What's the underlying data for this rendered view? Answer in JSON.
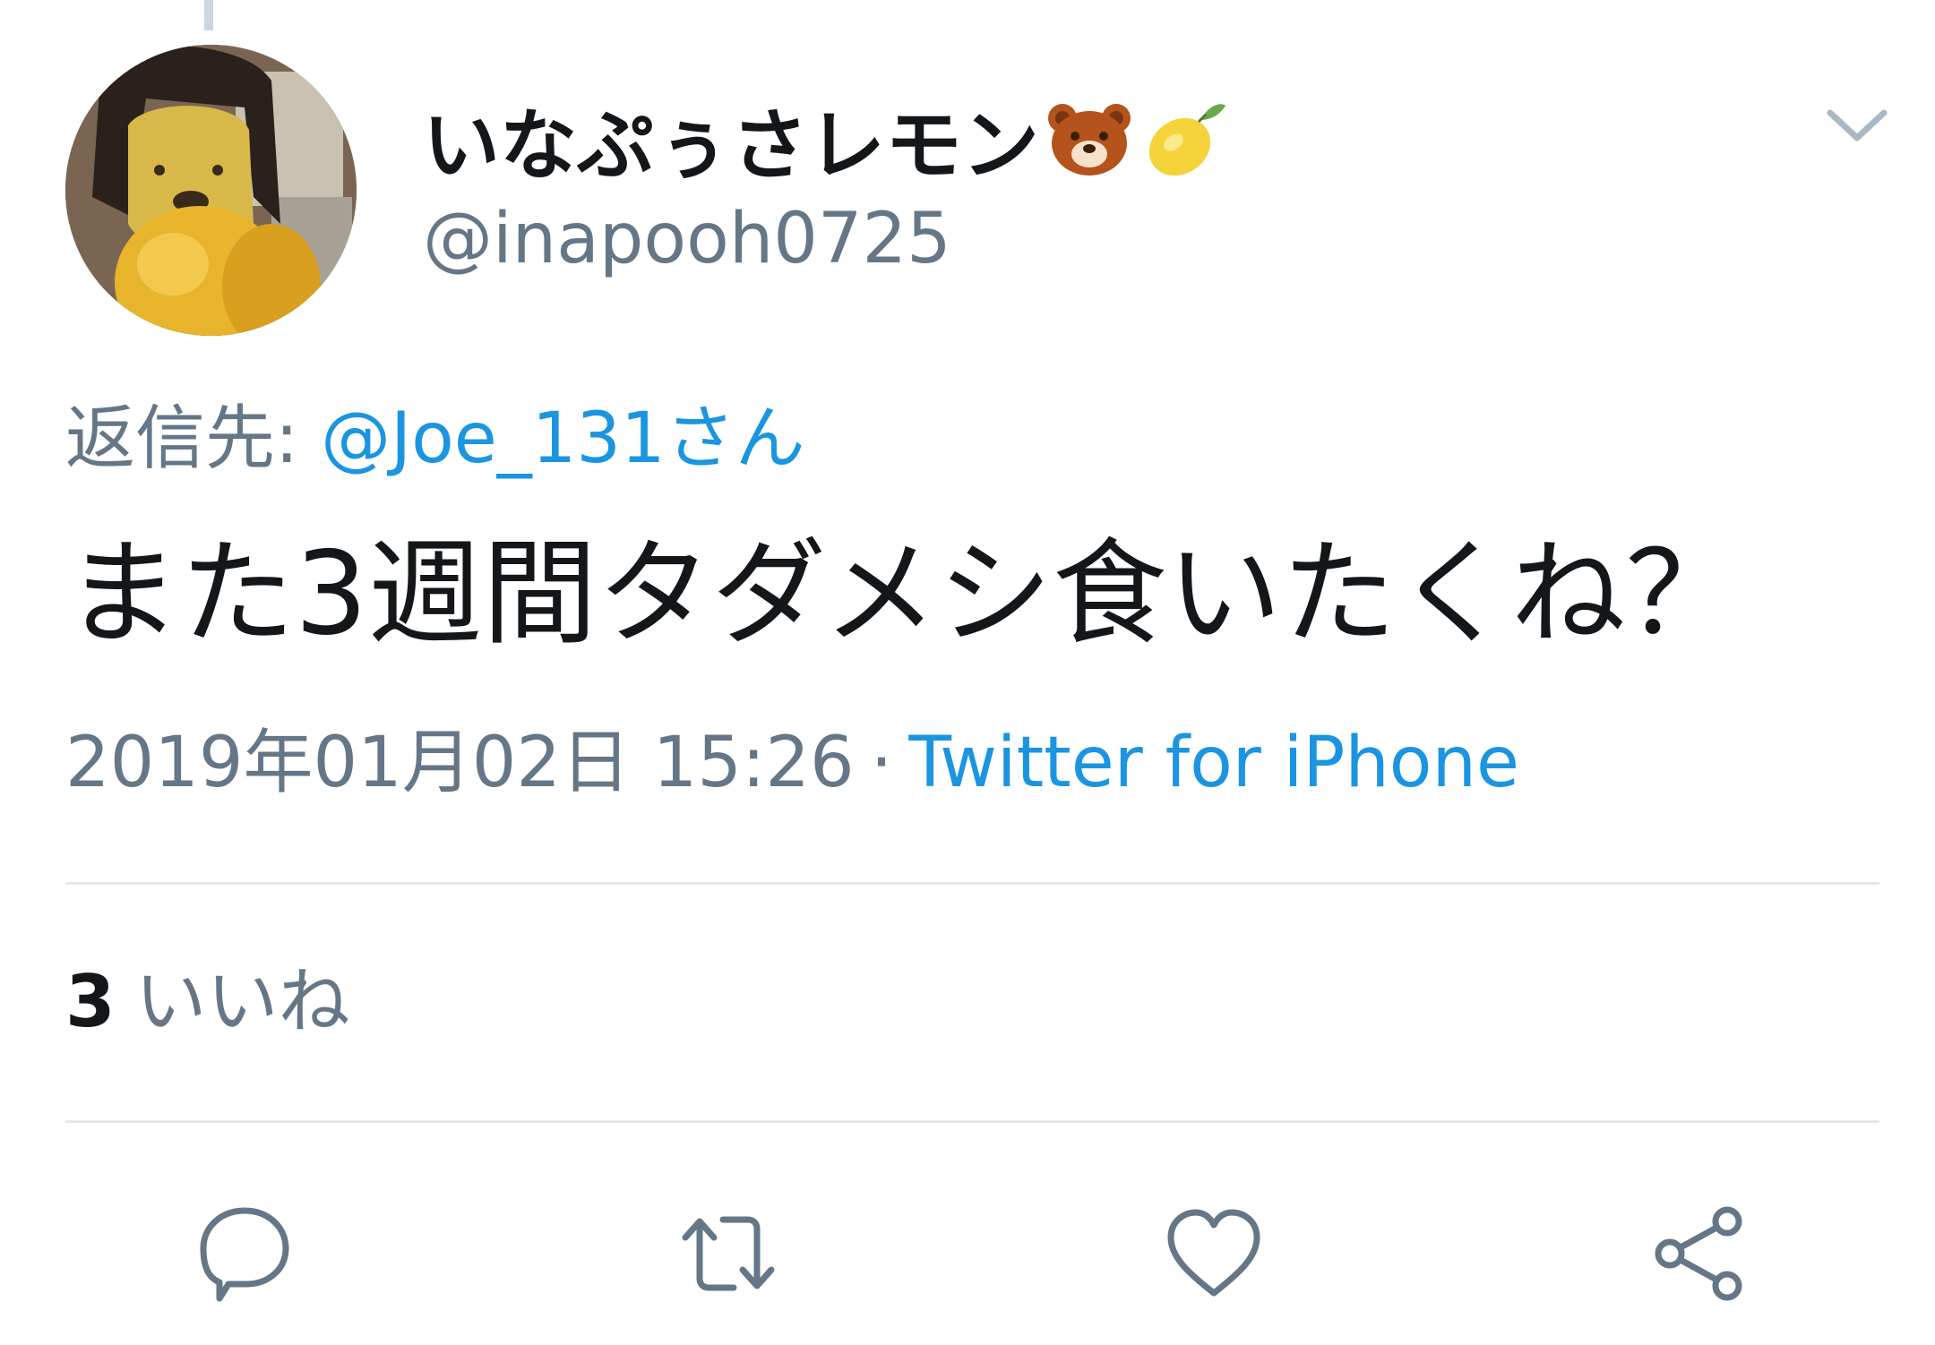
{
  "tweet": {
    "display_name": "いなぷぅさレモン",
    "name_emojis": [
      "bear-face-emoji",
      "lemon-emoji"
    ],
    "handle": "@inapooh0725",
    "reply_prefix": "返信先:",
    "reply_target": "@Joe_131さん",
    "text": "また3週間タダメシ食いたくね？",
    "timestamp": "2019年01月02日 15:26",
    "separator": "·",
    "source": "Twitter for iPhone",
    "likes_count": "3",
    "likes_label": "いいね"
  },
  "actions": [
    {
      "name": "reply",
      "icon": "speech-bubble-icon"
    },
    {
      "name": "retweet",
      "icon": "retweet-arrows-icon"
    },
    {
      "name": "like",
      "icon": "heart-icon"
    },
    {
      "name": "share",
      "icon": "share-nodes-icon"
    }
  ],
  "colors": {
    "text_primary": "#14171a",
    "text_secondary": "#657786",
    "link": "#1b95e0",
    "divider": "#e1e8ed",
    "icon": "#657786"
  }
}
